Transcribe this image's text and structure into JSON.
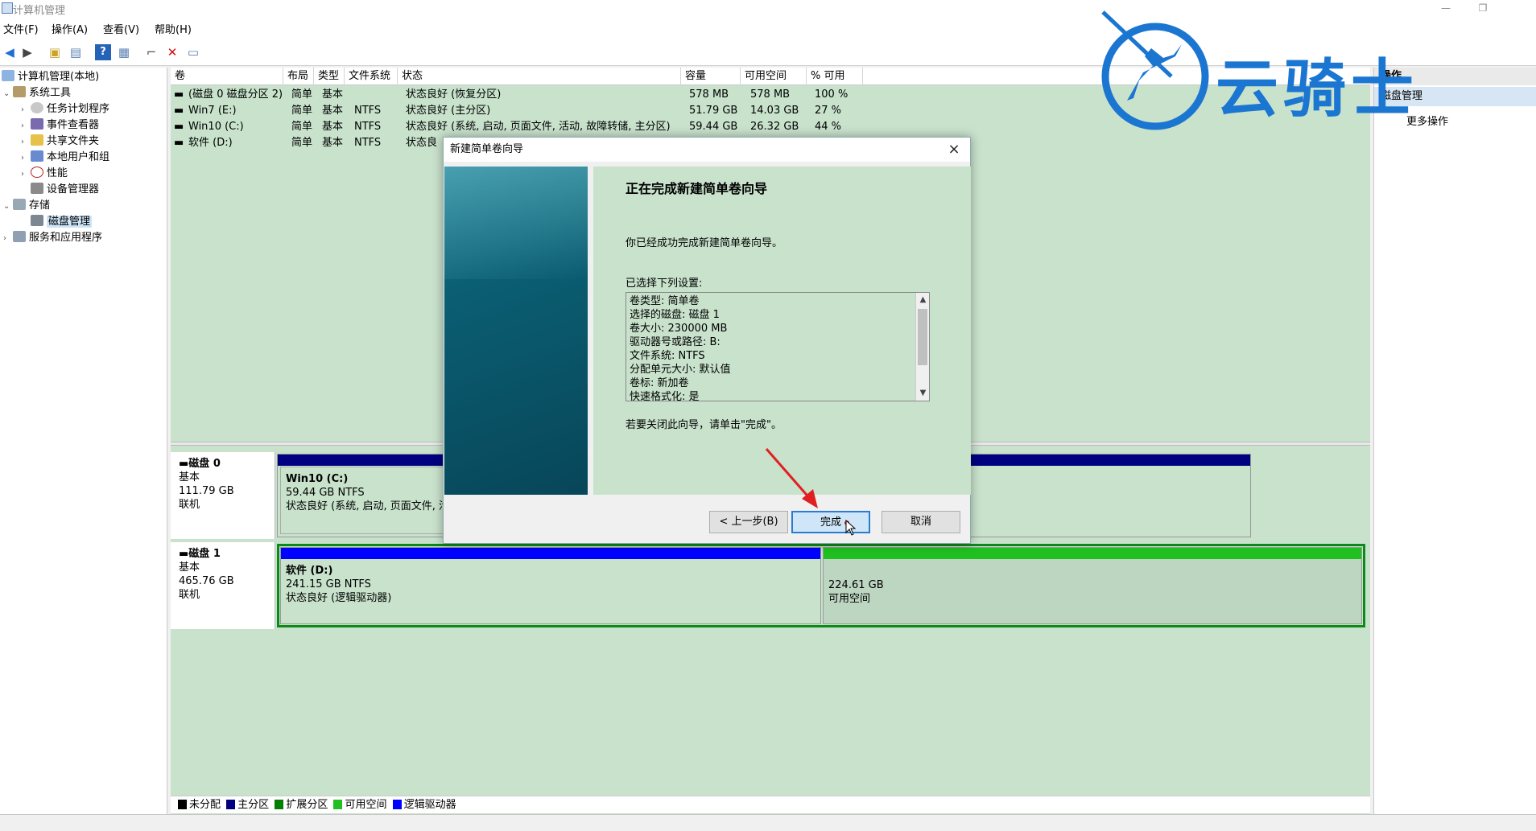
{
  "window": {
    "title": "计算机管理",
    "min_label": "—",
    "max_label": "❐"
  },
  "menu": [
    "文件(F)",
    "操作(A)",
    "查看(V)",
    "帮助(H)"
  ],
  "tree": [
    {
      "label": "计算机管理(本地)"
    },
    {
      "label": "系统工具"
    },
    {
      "label": "任务计划程序"
    },
    {
      "label": "事件查看器"
    },
    {
      "label": "共享文件夹"
    },
    {
      "label": "本地用户和组"
    },
    {
      "label": "性能"
    },
    {
      "label": "设备管理器"
    },
    {
      "label": "存储"
    },
    {
      "label": "磁盘管理"
    },
    {
      "label": "服务和应用程序"
    }
  ],
  "volume_list": {
    "columns": [
      "卷",
      "布局",
      "类型",
      "文件系统",
      "状态",
      "容量",
      "可用空间",
      "% 可用"
    ],
    "rows": [
      [
        "(磁盘 0 磁盘分区 2)",
        "简单",
        "基本",
        "",
        "状态良好 (恢复分区)",
        "578 MB",
        "578 MB",
        "100 %"
      ],
      [
        "Win7 (E:)",
        "简单",
        "基本",
        "NTFS",
        "状态良好 (主分区)",
        "51.79 GB",
        "14.03 GB",
        "27 %"
      ],
      [
        "Win10 (C:)",
        "简单",
        "基本",
        "NTFS",
        "状态良好 (系统, 启动, 页面文件, 活动, 故障转储, 主分区)",
        "59.44 GB",
        "26.32 GB",
        "44 %"
      ],
      [
        "软件 (D:)",
        "简单",
        "基本",
        "NTFS",
        "状态良",
        "",
        "",
        ""
      ]
    ]
  },
  "disks": [
    {
      "name": "磁盘 0",
      "type": "基本",
      "size": "111.79 GB",
      "state": "联机",
      "partitions": [
        {
          "name": "Win10  (C:)",
          "size": "59.44 GB NTFS",
          "status": "状态良好 (系统, 启动, 页面文件, 活"
        }
      ]
    },
    {
      "name": "磁盘 1",
      "type": "基本",
      "size": "465.76 GB",
      "state": "联机",
      "partitions": [
        {
          "name": "软件  (D:)",
          "size": "241.15 GB NTFS",
          "status": "状态良好 (逻辑驱动器)"
        },
        {
          "name": "",
          "size": "224.61 GB",
          "status": "可用空间"
        }
      ]
    }
  ],
  "legend": [
    {
      "label": "未分配",
      "color": "#000000"
    },
    {
      "label": "主分区",
      "color": "#000080"
    },
    {
      "label": "扩展分区",
      "color": "#008000"
    },
    {
      "label": "可用空间",
      "color": "#20c020"
    },
    {
      "label": "逻辑驱动器",
      "color": "#0000ff"
    }
  ],
  "actions": {
    "header": "操作",
    "section": "磁盘管理",
    "more": "更多操作"
  },
  "watermark": {
    "text": "云骑士"
  },
  "dialog": {
    "title": "新建简单卷向导",
    "close": "×",
    "heading": "正在完成新建简单卷向导",
    "success_text": "你已经成功完成新建简单卷向导。",
    "settings_label": "已选择下列设置:",
    "settings": [
      "卷类型: 简单卷",
      "选择的磁盘: 磁盘 1",
      "卷大小: 230000 MB",
      "驱动器号或路径: B:",
      "文件系统: NTFS",
      "分配单元大小: 默认值",
      "卷标: 新加卷",
      "快速格式化: 是"
    ],
    "close_hint": "若要关闭此向导，请单击\"完成\"。",
    "back_button": "< 上一步(B)",
    "finish_button": "完成",
    "cancel_button": "取消"
  },
  "colors": {
    "accent": "#2b7bd1",
    "primary_bar": "#000080",
    "logical_bar": "#0000ff",
    "free_bar": "#20c020",
    "pane_bg": "#c8e2cc",
    "annotation": "#e02020"
  }
}
